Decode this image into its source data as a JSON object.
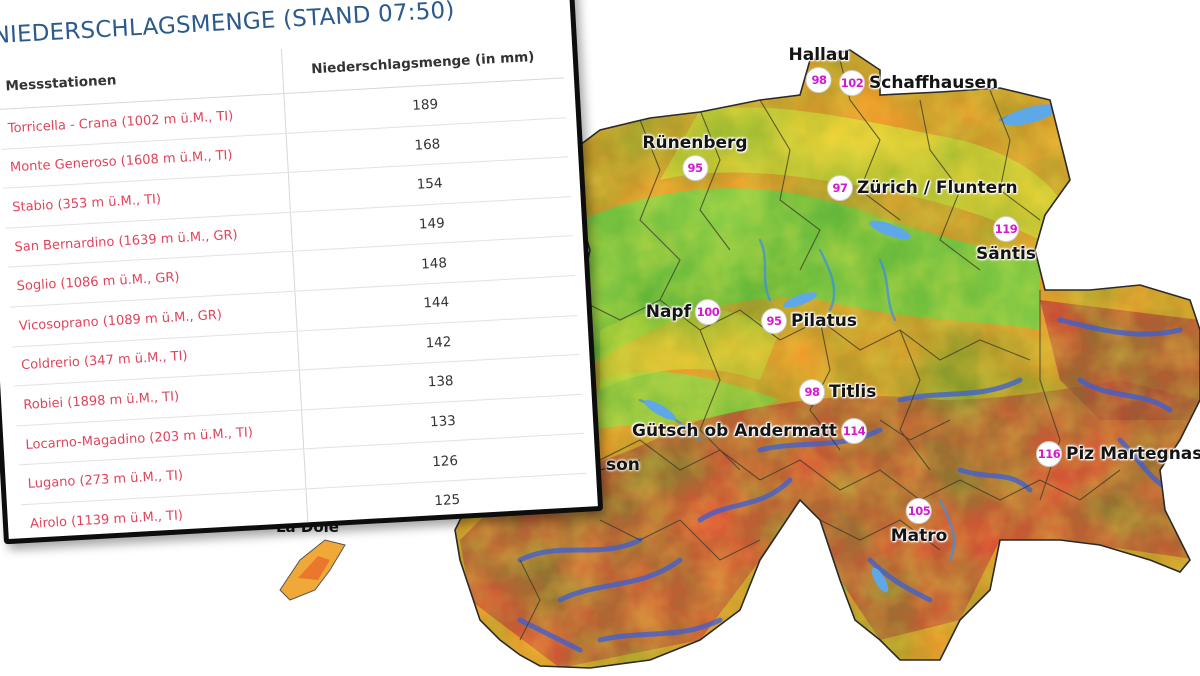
{
  "card": {
    "title": "NIEDERSCHLAGSMENGE (STAND 07:50)",
    "columns": [
      "Messstationen",
      "Niederschlagsmenge (in mm)"
    ],
    "rows": [
      {
        "station": "Torricella - Crana (1002 m ü.M., TI)",
        "value": "189"
      },
      {
        "station": "Monte Generoso (1608 m ü.M., TI)",
        "value": "168"
      },
      {
        "station": "Stabio (353 m ü.M., TI)",
        "value": "154"
      },
      {
        "station": "San Bernardino (1639 m ü.M., GR)",
        "value": "149"
      },
      {
        "station": "Soglio (1086 m ü.M., GR)",
        "value": "148"
      },
      {
        "station": "Vicosoprano (1089 m ü.M., GR)",
        "value": "144"
      },
      {
        "station": "Coldrerio (347 m ü.M., TI)",
        "value": "142"
      },
      {
        "station": "Robiei (1898 m ü.M., TI)",
        "value": "138"
      },
      {
        "station": "Locarno-Magadino (203 m ü.M., TI)",
        "value": "133"
      },
      {
        "station": "Lugano (273 m ü.M., TI)",
        "value": "126"
      },
      {
        "station": "Airolo (1139 m ü.M., TI)",
        "value": "125"
      }
    ]
  },
  "map": {
    "markers": [
      {
        "name": "Hallau",
        "value": "98"
      },
      {
        "name": "Schaffhausen",
        "value": "102"
      },
      {
        "name": "Rünenberg",
        "value": "95"
      },
      {
        "name": "Zürich / Fluntern",
        "value": "97"
      },
      {
        "name": "Säntis",
        "value": "119"
      },
      {
        "name": "Napf",
        "value": "100"
      },
      {
        "name": "Pilatus",
        "value": "95"
      },
      {
        "name": "Titlis",
        "value": "98"
      },
      {
        "name": "Gütsch ob Andermatt",
        "value": "114"
      },
      {
        "name": "Piz Martegnas",
        "value": "116"
      },
      {
        "name": "Matro",
        "value": "105"
      }
    ],
    "partial_labels": [
      "son",
      "La Dôle"
    ]
  },
  "colors": {
    "title_blue": "#2b5a8c",
    "station_link": "#e0445c",
    "badge_value": "#d21ccc",
    "relief_low": "#6fd23c",
    "relief_mid": "#e8e03a",
    "relief_orange": "#f08a24",
    "relief_high": "#d8443a",
    "relief_peak": "#3a5fd8"
  }
}
